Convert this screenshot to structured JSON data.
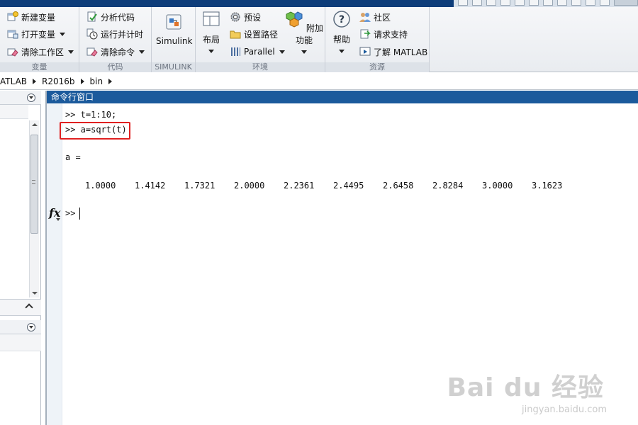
{
  "ribbon": {
    "variable": {
      "label": "变量",
      "new_variable": "新建变量",
      "open_variable": "打开变量",
      "clear_workspace": "清除工作区"
    },
    "code": {
      "label": "代码",
      "analyze_code": "分析代码",
      "run_and_time": "运行并计时",
      "clear_commands": "清除命令"
    },
    "simulink": {
      "label": "SIMULINK",
      "simulink": "Simulink"
    },
    "environment": {
      "label": "环境",
      "layout": "布局",
      "preferences": "预设",
      "set_path": "设置路径",
      "parallel": "Parallel",
      "addons": "附加功能"
    },
    "resources": {
      "label": "资源",
      "help": "帮助",
      "community": "社区",
      "request_support": "请求支持",
      "learn_matlab": "了解 MATLAB"
    }
  },
  "address_bar": {
    "crumbs": [
      "ATLAB",
      "R2016b",
      "bin"
    ]
  },
  "command_window": {
    "title": "命令行窗口",
    "lines": {
      "cmd1": ">> t=1:10;",
      "cmd2": ">> a=sqrt(t)",
      "result_name": "a =",
      "prompt": ">>"
    },
    "values": [
      "1.0000",
      "1.4142",
      "1.7321",
      "2.0000",
      "2.2361",
      "2.4495",
      "2.6458",
      "2.8284",
      "3.0000",
      "3.1623"
    ],
    "fx_label": "fx"
  },
  "watermark": {
    "main": "Bai du 经验",
    "sub": "jingyan.baidu.com"
  },
  "colors": {
    "command_title_bg": "#1b5a9c",
    "highlight_box": "#e02020"
  }
}
